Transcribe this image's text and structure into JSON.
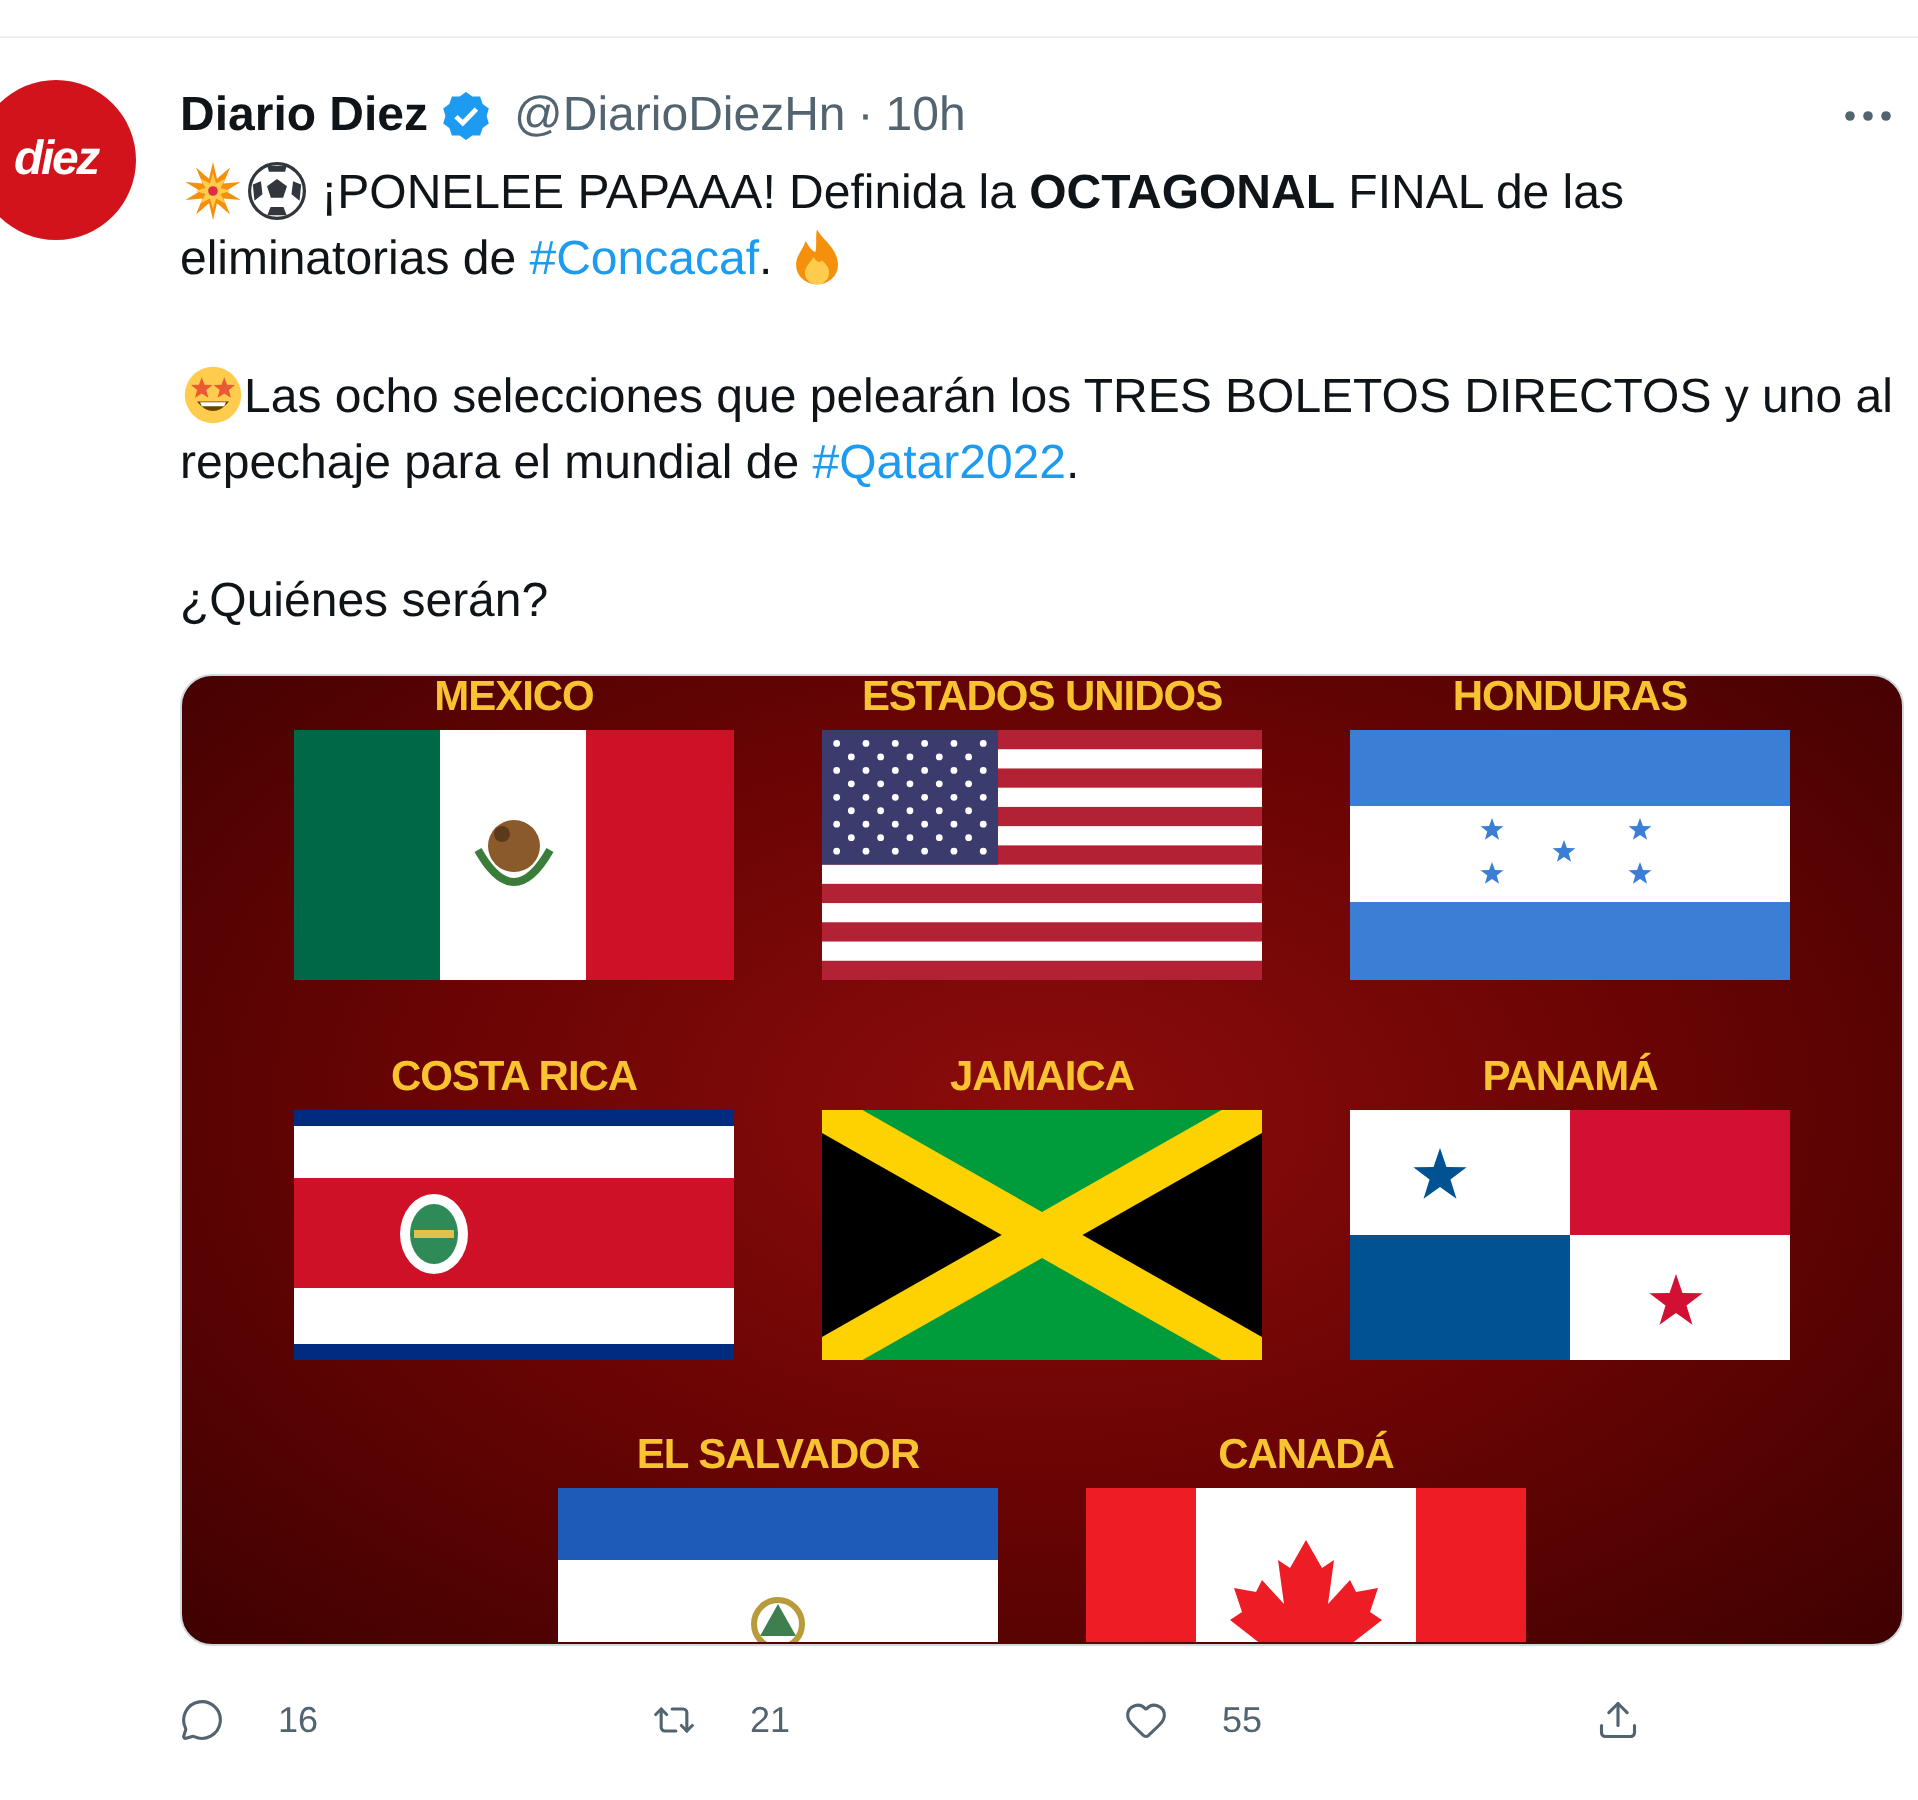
{
  "tweet": {
    "author": {
      "avatar_text": "diez",
      "name": "Diario Diez",
      "verified": true,
      "handle": "@DiarioDiezHn",
      "separator": "·",
      "time": "10h"
    },
    "body": [
      {
        "segments": [
          {
            "kind": "burst"
          },
          {
            "kind": "ball"
          },
          {
            "kind": "text",
            "text": " ¡PONELEE PAPAAA! Definida la **OCTAGONAL** FINAL de las eliminatorias de "
          },
          {
            "kind": "hashtag",
            "text": "#Concacaf"
          },
          {
            "kind": "text",
            "text": ". "
          },
          {
            "kind": "flame"
          }
        ]
      },
      {
        "segments": [
          {
            "kind": "starstruck"
          },
          {
            "kind": "text",
            "text": "Las ocho selecciones que pelearán los TRES BOLETOS DIRECTOS y uno al repechaje para el mundial de "
          },
          {
            "kind": "hashtag",
            "text": "#Qatar2022"
          },
          {
            "kind": "text",
            "text": "."
          }
        ]
      },
      {
        "segments": [
          {
            "kind": "text",
            "text": "¿Quiénes serán?"
          }
        ]
      }
    ],
    "media": {
      "rows": [
        [
          {
            "name": "MEXICO",
            "kind": "mexico"
          },
          {
            "name": "ESTADOS UNIDOS",
            "kind": "usa"
          },
          {
            "name": "HONDURAS",
            "kind": "honduras"
          }
        ],
        [
          {
            "name": "COSTA RICA",
            "kind": "costarica"
          },
          {
            "name": "JAMAICA",
            "kind": "jamaica"
          },
          {
            "name": "PANAMÁ",
            "kind": "panama"
          }
        ],
        [
          {
            "name": "EL SALVADOR",
            "kind": "elsalvador"
          },
          {
            "name": "CANADÁ",
            "kind": "canada"
          }
        ]
      ]
    },
    "actions": [
      {
        "kind": "reply",
        "count": "16"
      },
      {
        "kind": "retweet",
        "count": "21"
      },
      {
        "kind": "like",
        "count": "55"
      },
      {
        "kind": "share"
      }
    ]
  }
}
